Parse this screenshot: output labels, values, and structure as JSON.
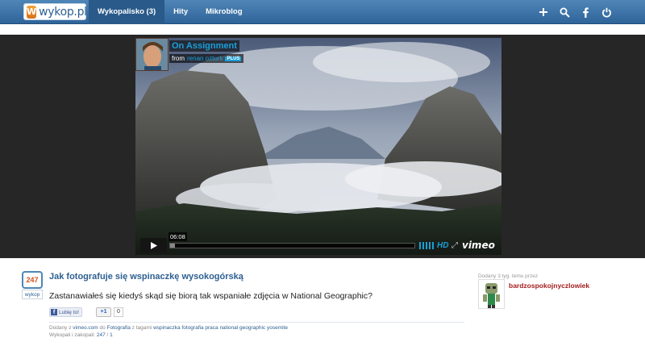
{
  "nav": {
    "logo_text": "wykop.pl",
    "logo_badge": "W",
    "items": [
      {
        "label": "Wykopalisko (3)",
        "active": true
      },
      {
        "label": "Hity",
        "active": false
      },
      {
        "label": "Mikroblog",
        "active": false
      }
    ],
    "icons": [
      "plus-icon",
      "search-icon",
      "facebook-icon",
      "power-icon"
    ]
  },
  "video": {
    "title": "On Assignment",
    "from_label": "from",
    "author": "renan ozturk",
    "plus_badge": "PLUS",
    "time": "06:08",
    "progress": 0.02,
    "hd_label": "HD",
    "brand": "vimeo"
  },
  "entry": {
    "votes": "247",
    "vote_button": "wykop",
    "title": "Jak fotografuje się wspinaczkę wysokogórską",
    "description": "Zastanawiałeś się kiedyś skąd się biorą tak wspaniałe zdjęcia w National Geographic?",
    "fb_like": "Lubię to!",
    "gplus_label": "+1",
    "gplus_count": "0",
    "meta": {
      "added_prefix": "Dodany z",
      "source": "vimeo.com",
      "to_word": "do",
      "category": "Fotografia",
      "tags_prefix": "z tagami",
      "tags": "wspinaczka fotografia praca national geographic yosemite",
      "votes_prefix": "Wykopali i zakopali:",
      "votes_up": "247",
      "votes_sep": "/",
      "votes_down": "1"
    }
  },
  "sidebar": {
    "added_text": "Dodany 3 tyg. temu przez",
    "username": "bardzospokojnyczlowiek"
  },
  "colors": {
    "nav_blue": "#2f6499",
    "link_blue": "#2d5f91",
    "vimeo_blue": "#1a9fd8",
    "username_red": "#a31e1e"
  }
}
